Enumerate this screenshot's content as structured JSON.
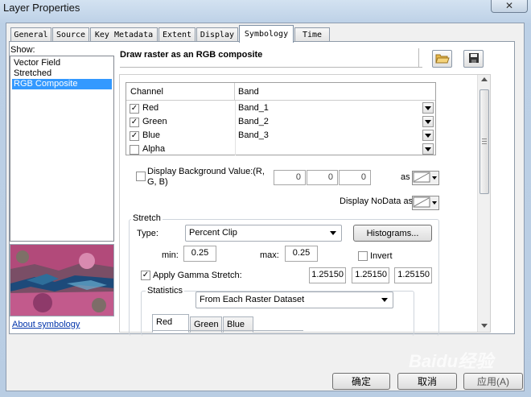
{
  "window": {
    "title": "Layer Properties",
    "close_glyph": "✕"
  },
  "tabs": [
    {
      "label": "General"
    },
    {
      "label": "Source"
    },
    {
      "label": "Key Metadata"
    },
    {
      "label": "Extent"
    },
    {
      "label": "Display"
    },
    {
      "label": "Symbology"
    },
    {
      "label": "Time"
    }
  ],
  "active_tab": "Symbology",
  "left": {
    "show_label": "Show:",
    "items": [
      {
        "label": "Vector Field"
      },
      {
        "label": "Stretched"
      },
      {
        "label": "RGB Composite"
      }
    ],
    "selected": "RGB Composite",
    "about_link": "About symbology"
  },
  "main": {
    "heading": "Draw raster as an RGB composite",
    "channel_header": "Channel",
    "band_header": "Band",
    "channels": [
      {
        "name": "Red",
        "band": "Band_1",
        "checked": true
      },
      {
        "name": "Green",
        "band": "Band_2",
        "checked": true
      },
      {
        "name": "Blue",
        "band": "Band_3",
        "checked": true
      },
      {
        "name": "Alpha",
        "band": "",
        "checked": false
      }
    ],
    "background": {
      "label": "Display Background Value:(R, G, B)",
      "checked": false,
      "values": [
        "0",
        "0",
        "0"
      ],
      "as_label": "as"
    },
    "nodata_label": "Display NoData as",
    "stretch": {
      "group_label": "Stretch",
      "type_label": "Type:",
      "type_value": "Percent Clip",
      "histograms_button": "Histograms...",
      "min_label": "min:",
      "min_value": "0.25",
      "max_label": "max:",
      "max_value": "0.25",
      "invert_label": "Invert",
      "invert_checked": false,
      "gamma_label": "Apply Gamma Stretch:",
      "gamma_checked": true,
      "gamma_values": [
        "1.25150",
        "1.25150",
        "1.25150"
      ],
      "statistics_label": "Statistics",
      "statistics_value": "From Each Raster Dataset",
      "stat_tabs": [
        "Red",
        "Green",
        "Blue"
      ]
    }
  },
  "footer": {
    "ok": "确定",
    "cancel": "取消",
    "apply": "应用(A)"
  },
  "watermark": "Baidu经验"
}
